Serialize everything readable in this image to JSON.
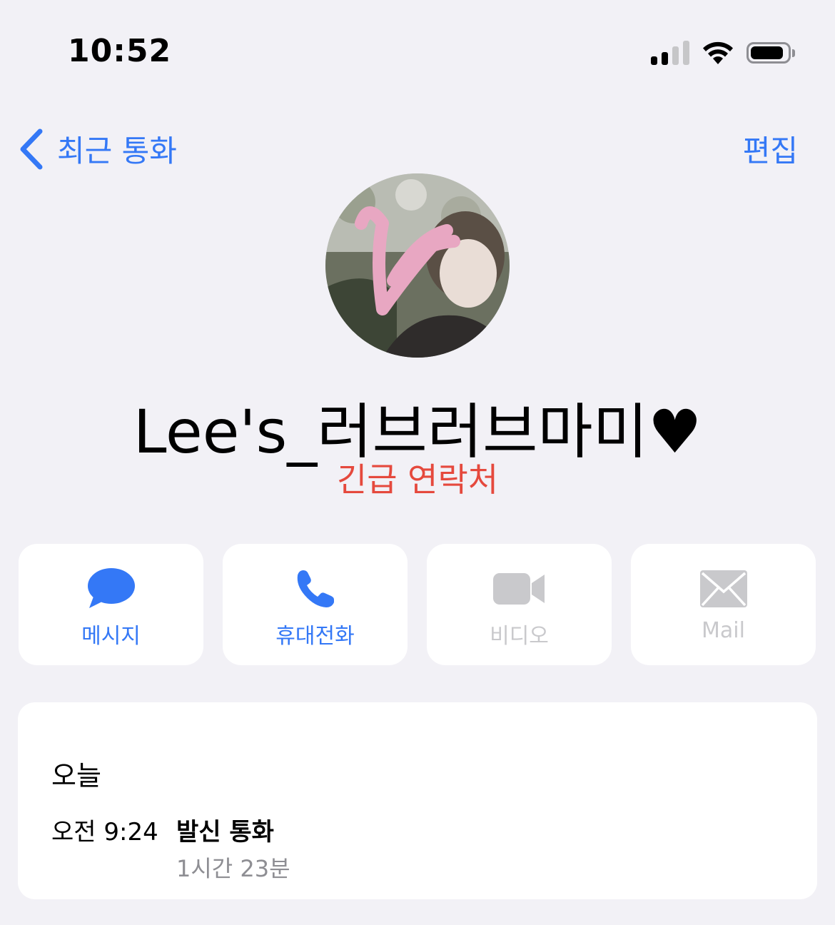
{
  "status_bar": {
    "time": "10:52",
    "battery_level": 0.9
  },
  "nav": {
    "back_label": "최근 통화",
    "edit_label": "편집"
  },
  "contact": {
    "name": "Lee's_러브러브마미♥",
    "tag": "긴급 연락처",
    "avatar_icon": "contact-photo"
  },
  "actions": [
    {
      "label": "메시지",
      "icon": "message-bubble-icon",
      "enabled": true
    },
    {
      "label": "휴대전화",
      "icon": "phone-icon",
      "enabled": true
    },
    {
      "label": "비디오",
      "icon": "video-camera-icon",
      "enabled": false
    },
    {
      "label": "Mail",
      "icon": "mail-icon",
      "enabled": false
    }
  ],
  "history": {
    "day": "오늘",
    "entries": [
      {
        "time": "오전 9:24",
        "type": "발신 통화",
        "duration": "1시간 23분"
      }
    ]
  },
  "colors": {
    "accent": "#3478f6",
    "emergency": "#e5493d",
    "disabled": "#c9c9cc",
    "background": "#f2f1f6"
  }
}
